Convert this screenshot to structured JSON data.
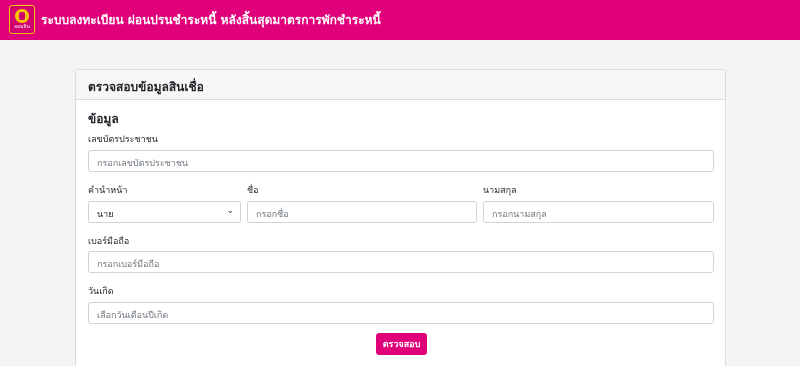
{
  "header": {
    "logo_text": "ออมสิน",
    "title": "ระบบลงทะเบียน ผ่อนปรนชำระหนี้ หลังสิ้นสุดมาตรการพักชำระหนี้"
  },
  "card": {
    "title": "ตรวจสอบข้อมูลสินเชื่อ",
    "section_title": "ข้อมูล",
    "id_card": {
      "label": "เลขบัตรประชาชน",
      "placeholder": "กรอกเลขบัตรประชาชน"
    },
    "prefix": {
      "label": "คำนำหน้า",
      "value": "นาย"
    },
    "first_name": {
      "label": "ชื่อ",
      "placeholder": "กรอกชื่อ"
    },
    "last_name": {
      "label": "นามสกุล",
      "placeholder": "กรอกนามสกุล"
    },
    "phone": {
      "label": "เบอร์มือถือ",
      "placeholder": "กรอกเบอร์มือถือ"
    },
    "birthdate": {
      "label": "วันเกิด",
      "placeholder": "เลือกวันเดือนปีเกิด"
    },
    "submit_label": "ตรวจสอบ"
  },
  "icons": {
    "logo": "gsb-logo-icon",
    "select_arrow": "chevron-down-icon"
  },
  "colors": {
    "brand": "#e0007a",
    "gold": "#f5c400"
  }
}
